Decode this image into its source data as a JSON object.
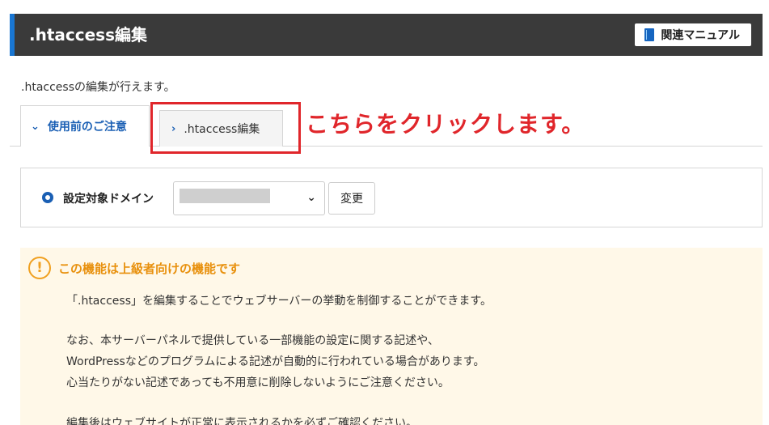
{
  "header": {
    "title": ".htaccess編集",
    "manual_label": "関連マニュアル"
  },
  "intro": ".htaccessの編集が行えます。",
  "tabs": [
    {
      "label": "使用前のご注意",
      "active": true
    },
    {
      "label": ".htaccess編集",
      "active": false
    }
  ],
  "annotation": "こちらをクリックします。",
  "domain": {
    "label": "設定対象ドメイン",
    "change_label": "変更"
  },
  "warning": {
    "title": "この機能は上級者向けの機能です",
    "lines": [
      "「.htaccess」を編集することでウェブサーバーの挙動を制御することができます。",
      "なお、本サーバーパネルで提供している一部機能の設定に関する記述や、",
      "WordPressなどのプログラムによる記述が自動的に行われている場合があります。",
      "心当たりがない記述であっても不用意に削除しないようにご注意ください。",
      "編集後はウェブサイトが正常に表示されるかを必ずご確認ください。"
    ]
  },
  "colors": {
    "accent": "#1976d2",
    "annotation": "#e0262b",
    "warning": "#e8900c"
  }
}
